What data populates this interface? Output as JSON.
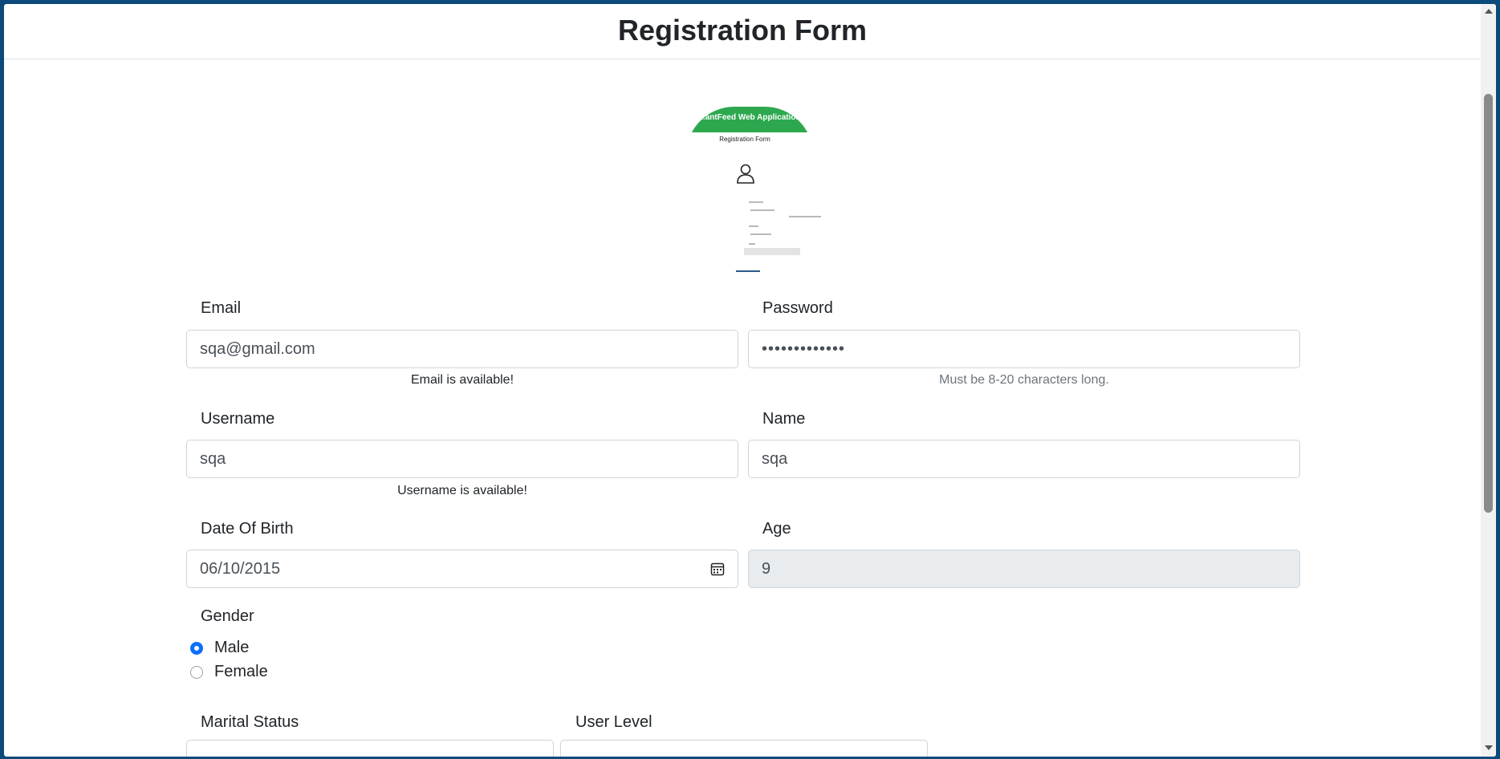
{
  "header": {
    "title": "Registration Form"
  },
  "preview": {
    "banner_text": "...antFeed Web Application",
    "subtitle": "Registration Form",
    "icon": "user-icon"
  },
  "form": {
    "email": {
      "label": "Email",
      "value": "sqa@gmail.com",
      "hint": "Email is available!"
    },
    "password": {
      "label": "Password",
      "value": "•••••••••••••",
      "hint": "Must be 8-20 characters long."
    },
    "username": {
      "label": "Username",
      "value": "sqa",
      "hint": "Username is available!"
    },
    "name": {
      "label": "Name",
      "value": "sqa"
    },
    "dob": {
      "label": "Date Of Birth",
      "value": "06/10/2015",
      "icon": "calendar-icon"
    },
    "age": {
      "label": "Age",
      "value": "9"
    },
    "gender": {
      "label": "Gender",
      "options": [
        {
          "label": "Male",
          "checked": true
        },
        {
          "label": "Female",
          "checked": false
        }
      ]
    },
    "marital_status": {
      "label": "Marital Status"
    },
    "user_level": {
      "label": "User Level"
    }
  },
  "colors": {
    "accent": "#0d6efd",
    "brand_green": "#2ea84e",
    "background": "#0b4a7a"
  }
}
